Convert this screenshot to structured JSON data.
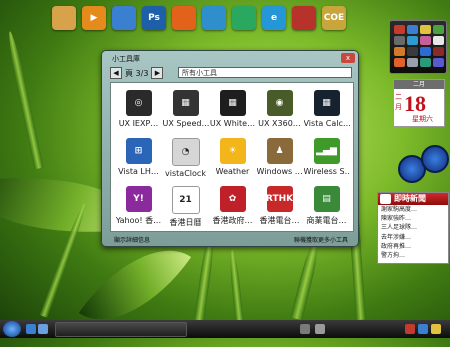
{
  "dock": {
    "icons": [
      {
        "icon": "paint-palette-icon",
        "glyph": "",
        "color": "#d8a24a"
      },
      {
        "icon": "media-player-icon",
        "glyph": "▶",
        "color": "#e58b1c"
      },
      {
        "icon": "computer-icon",
        "glyph": "",
        "color": "#3a7fd0"
      },
      {
        "icon": "photoshop-icon",
        "glyph": "Ps",
        "color": "#1d5fa8"
      },
      {
        "icon": "firefox-icon",
        "glyph": "",
        "color": "#e2621b"
      },
      {
        "icon": "tools-icon",
        "glyph": "",
        "color": "#2f8fcc"
      },
      {
        "icon": "network-tools-icon",
        "glyph": "",
        "color": "#2aa860"
      },
      {
        "icon": "internet-explorer-icon",
        "glyph": "e",
        "color": "#2596d6"
      },
      {
        "icon": "download-icon",
        "glyph": "",
        "color": "#b8322c"
      },
      {
        "icon": "coe-icon",
        "glyph": "COE",
        "color": "#c9a63c"
      }
    ]
  },
  "gallery": {
    "title": "小工具庫",
    "page_label": "頁 3/3",
    "search_value": "所有小工具",
    "close_label": "x",
    "prev_label": "◀",
    "next_label": "▶",
    "show_details": "顯示詳細信息",
    "get_more": "聯機獲取更多小工具",
    "gadgets": [
      {
        "label": "UX IEXP…",
        "icon": "ux-iexp-icon",
        "color": "#2a2a2a",
        "glyph": "◎"
      },
      {
        "label": "UX Speed…",
        "icon": "ux-speed-icon",
        "color": "#333333",
        "glyph": "▦"
      },
      {
        "label": "UX White…",
        "icon": "ux-white-icon",
        "color": "#1e1e1e",
        "glyph": "▦"
      },
      {
        "label": "UX X360…",
        "icon": "ux-x360-icon",
        "color": "#4a5b2a",
        "glyph": "◉"
      },
      {
        "label": "Vista Calc…",
        "icon": "calculator-icon",
        "color": "#16222e",
        "glyph": "▦"
      },
      {
        "label": "Vista LH…",
        "icon": "vista-logo-icon",
        "color": "#2b65b8",
        "glyph": "⊞"
      },
      {
        "label": "vistaClock",
        "icon": "clock-icon",
        "color": "#d6d6d6",
        "glyph": "◔"
      },
      {
        "label": "Weather",
        "icon": "weather-sun-icon",
        "color": "#f2b51a",
        "glyph": "☀"
      },
      {
        "label": "Windows …",
        "icon": "windows-users-icon",
        "color": "#8a6a3a",
        "glyph": "♟"
      },
      {
        "label": "Wireless S…",
        "icon": "wireless-signal-icon",
        "color": "#3f9a2a",
        "glyph": "▂▄▆"
      },
      {
        "label": "Yahoo! 香…",
        "icon": "yahoo-icon",
        "color": "#8a2a9c",
        "glyph": "Y!"
      },
      {
        "label": "香港日曆",
        "icon": "calendar-21-icon",
        "color": "#ffffff",
        "glyph": "21"
      },
      {
        "label": "香港政府…",
        "icon": "hk-gov-icon",
        "color": "#c0202a",
        "glyph": "✿"
      },
      {
        "label": "香港電台…",
        "icon": "rthk-icon",
        "color": "#c82828",
        "glyph": "RTHK"
      },
      {
        "label": "商業電台…",
        "icon": "radio-station-icon",
        "color": "#3a8a3a",
        "glyph": "▤"
      }
    ]
  },
  "sidebar": {
    "launcher_colors": [
      "#c23b2d",
      "#3a7fd0",
      "#e1c340",
      "#4aa23f",
      "#6a6a6a",
      "#2d9ad0",
      "#c95f9a",
      "#e8e8e8",
      "#d07a2a",
      "#3a3a3a",
      "#2c6bd4",
      "#8a2a2a",
      "#e0622a",
      "#9aa0aa",
      "#2a9a7a",
      "#5a5ad0"
    ],
    "calendar": {
      "top": "二月",
      "day": "18",
      "month": "二月",
      "weekday": "星期六"
    },
    "news": {
      "title": "即時新聞",
      "items": [
        "謝家駒高度…",
        "陳家強昨…",
        "三人足球隊…",
        "去年涉嫌…",
        "政府再推…",
        "警方拘…"
      ]
    }
  },
  "taskbar": {
    "tray_time": ""
  }
}
